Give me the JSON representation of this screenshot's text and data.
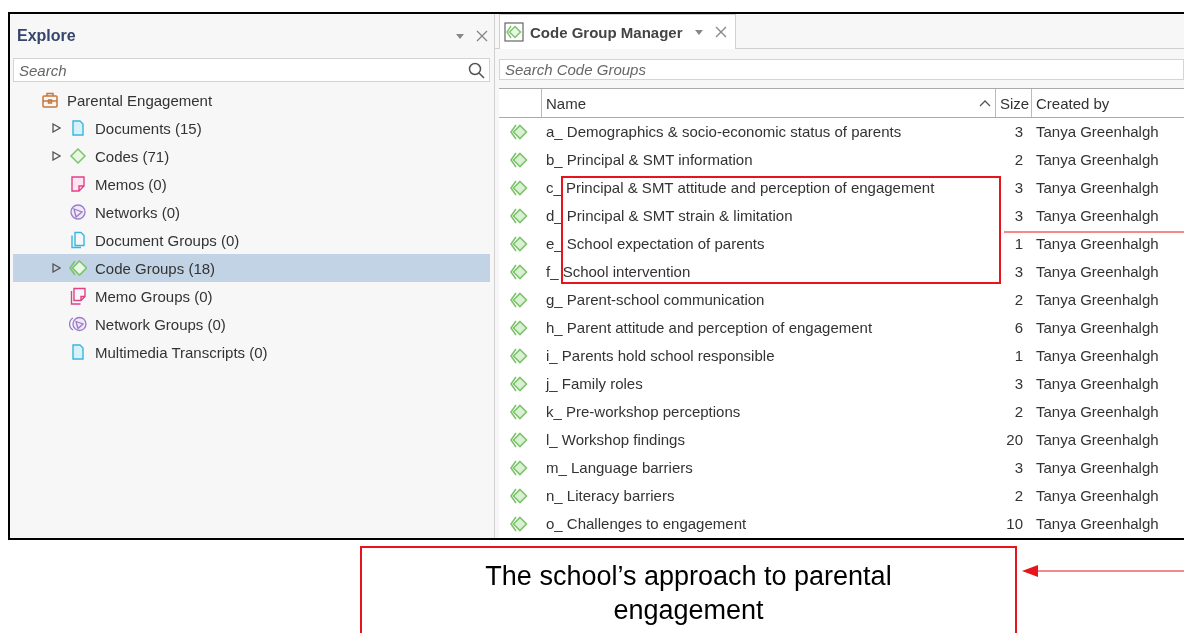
{
  "explore": {
    "title": "Explore",
    "search": {
      "placeholder": "Search"
    },
    "tree": [
      {
        "label": "Parental Engagement",
        "kind": "project",
        "selected": false,
        "children": [
          {
            "label": "Documents (15)",
            "kind": "documents",
            "expandable": true,
            "selected": false
          },
          {
            "label": "Codes (71)",
            "kind": "codes",
            "expandable": true,
            "selected": false
          },
          {
            "label": "Memos (0)",
            "kind": "memos",
            "expandable": false,
            "selected": false
          },
          {
            "label": "Networks (0)",
            "kind": "networks",
            "expandable": false,
            "selected": false
          },
          {
            "label": "Document Groups (0)",
            "kind": "document_groups",
            "expandable": false,
            "selected": false
          },
          {
            "label": "Code Groups (18)",
            "kind": "code_groups",
            "expandable": true,
            "selected": true
          },
          {
            "label": "Memo Groups (0)",
            "kind": "memo_groups",
            "expandable": false,
            "selected": false
          },
          {
            "label": "Network Groups (0)",
            "kind": "network_groups",
            "expandable": false,
            "selected": false
          },
          {
            "label": "Multimedia Transcripts (0)",
            "kind": "transcripts",
            "expandable": false,
            "selected": false
          }
        ]
      }
    ]
  },
  "manager": {
    "tab": {
      "label": "Code Group Manager",
      "selected": true
    },
    "search": {
      "placeholder": "Search Code Groups"
    },
    "columns": [
      {
        "label": "Name",
        "sorted": true
      },
      {
        "label": "Size",
        "sorted": false
      },
      {
        "label": "Created by",
        "sorted": false
      }
    ],
    "rows": [
      {
        "name": "a_ Demographics & socio-economic status of parents",
        "size": "3",
        "created_by": "Tanya Greenhalgh",
        "highlighted": false
      },
      {
        "name": "b_ Principal & SMT information",
        "size": "2",
        "created_by": "Tanya Greenhalgh",
        "highlighted": false
      },
      {
        "name": "c_ Principal & SMT attitude and perception of engagement",
        "size": "3",
        "created_by": "Tanya Greenhalgh",
        "highlighted": true
      },
      {
        "name": "d_ Principal & SMT strain & limitation",
        "size": "3",
        "created_by": "Tanya Greenhalgh",
        "highlighted": true
      },
      {
        "name": "e_ School expectation of parents",
        "size": "1",
        "created_by": "Tanya Greenhalgh",
        "highlighted": true
      },
      {
        "name": "f_ School intervention",
        "size": "3",
        "created_by": "Tanya Greenhalgh",
        "highlighted": true
      },
      {
        "name": "g_ Parent-school communication",
        "size": "2",
        "created_by": "Tanya Greenhalgh",
        "highlighted": false
      },
      {
        "name": "h_ Parent attitude and perception of engagement",
        "size": "6",
        "created_by": "Tanya Greenhalgh",
        "highlighted": false
      },
      {
        "name": "i_ Parents hold school responsible",
        "size": "1",
        "created_by": "Tanya Greenhalgh",
        "highlighted": false
      },
      {
        "name": "j_ Family roles",
        "size": "3",
        "created_by": "Tanya Greenhalgh",
        "highlighted": false
      },
      {
        "name": "k_ Pre-workshop perceptions",
        "size": "2",
        "created_by": "Tanya Greenhalgh",
        "highlighted": false
      },
      {
        "name": "l_ Workshop findings",
        "size": "20",
        "created_by": "Tanya Greenhalgh",
        "highlighted": false
      },
      {
        "name": "m_ Language barriers",
        "size": "3",
        "created_by": "Tanya Greenhalgh",
        "highlighted": false
      },
      {
        "name": "n_ Literacy barriers",
        "size": "2",
        "created_by": "Tanya Greenhalgh",
        "highlighted": false
      },
      {
        "name": "o_ Challenges to engagement",
        "size": "10",
        "created_by": "Tanya Greenhalgh",
        "highlighted": false
      }
    ]
  },
  "annotation": {
    "text": "The school’s approach to parental engagement"
  }
}
